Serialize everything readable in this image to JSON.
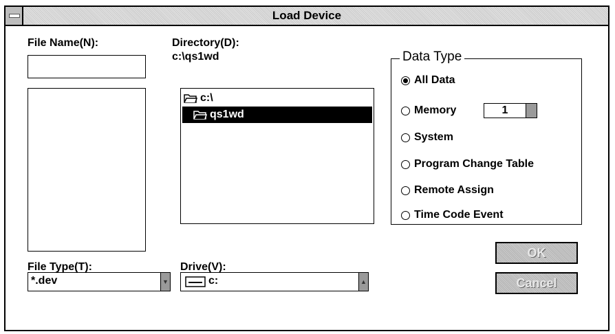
{
  "window": {
    "title": "Load Device"
  },
  "file_name": {
    "label": "File Name(N):",
    "value": ""
  },
  "directory": {
    "label": "Directory(D):",
    "path": "c:\\qs1wd",
    "items": [
      {
        "label": "c:\\"
      },
      {
        "label": "qs1wd"
      }
    ]
  },
  "data_type": {
    "title": "Data Type",
    "options": [
      {
        "label": "All Data",
        "selected": true
      },
      {
        "label": "Memory",
        "selected": false
      },
      {
        "label": "System",
        "selected": false
      },
      {
        "label": "Program Change Table",
        "selected": false
      },
      {
        "label": "Remote Assign",
        "selected": false
      },
      {
        "label": "Time Code Event",
        "selected": false
      }
    ],
    "memory_value": "1"
  },
  "file_type": {
    "label": "File Type(T):",
    "value": "*.dev"
  },
  "drive": {
    "label": "Drive(V):",
    "value": "c:"
  },
  "buttons": {
    "ok": "OK",
    "cancel": "Cancel"
  }
}
